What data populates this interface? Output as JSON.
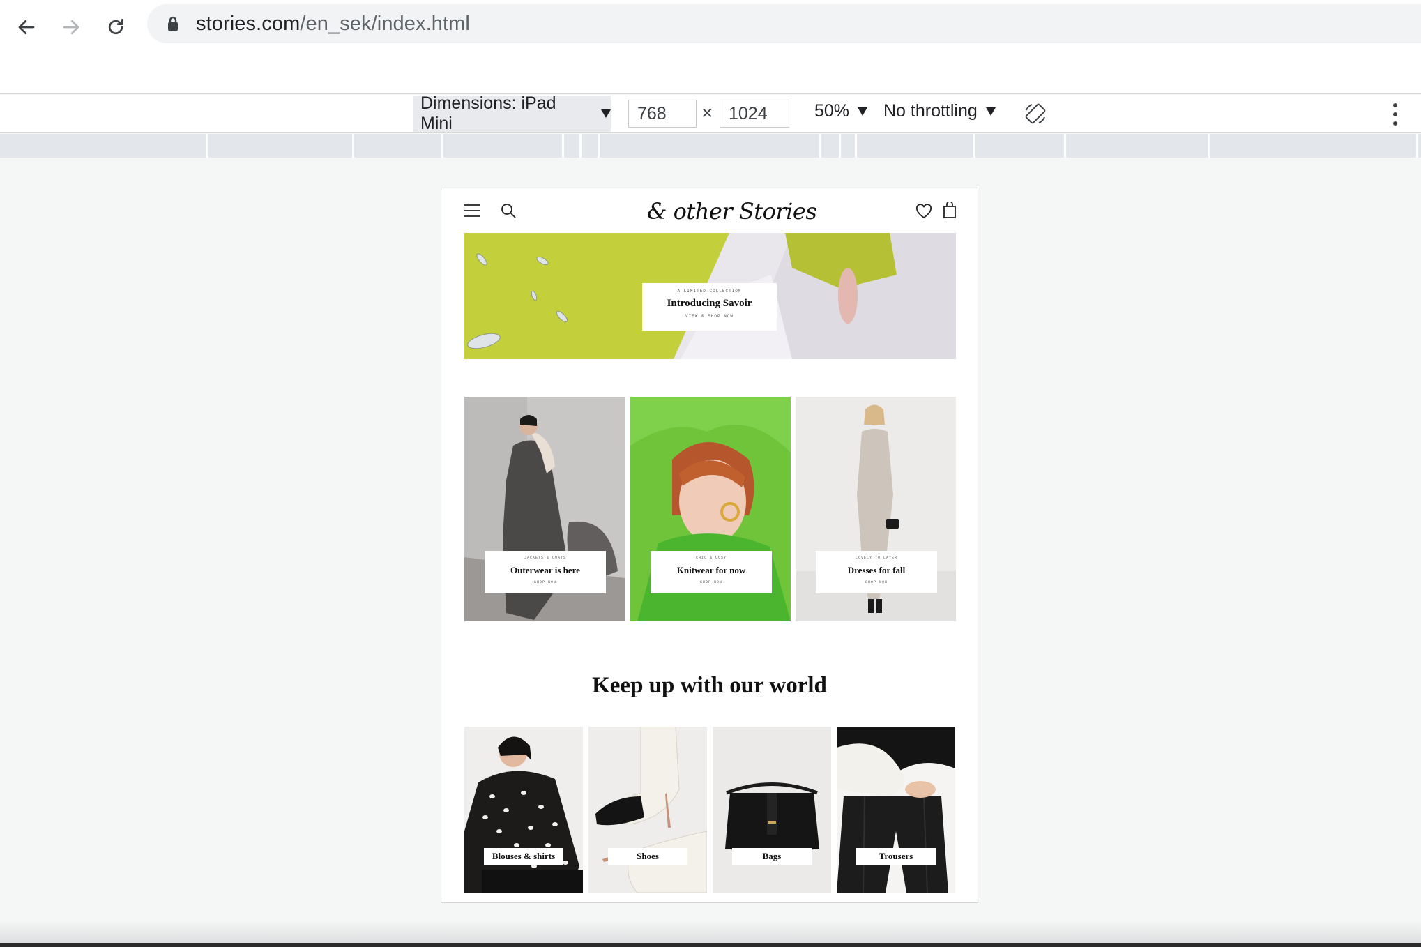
{
  "browser": {
    "url_host": "stories.com",
    "url_path": "/en_sek/index.html"
  },
  "devtools": {
    "dimensions_label": "Dimensions: iPad Mini",
    "width": "768",
    "times": "×",
    "height": "1024",
    "zoom": "50%",
    "throttling": "No throttling"
  },
  "site": {
    "logo": "& other Stories",
    "hero": {
      "kicker": "A LIMITED COLLECTION",
      "title": "Introducing Savoir",
      "cta": "VIEW & SHOP NOW"
    },
    "tiles": [
      {
        "kicker": "JACKETS & COATS",
        "title": "Outerwear is here",
        "cta": "SHOP NOW"
      },
      {
        "kicker": "CHIC & COSY",
        "title": "Knitwear for now",
        "cta": "SHOP NOW"
      },
      {
        "kicker": "LOVELY TO LAYER",
        "title": "Dresses for fall",
        "cta": "SHOP NOW"
      }
    ],
    "section_title": "Keep up with our world",
    "categories": [
      {
        "label": "Blouses & shirts"
      },
      {
        "label": "Shoes"
      },
      {
        "label": "Bags"
      },
      {
        "label": "Trousers"
      }
    ]
  },
  "colors": {
    "hero_lime": "#c3d03c",
    "knit_green": "#6fc43a"
  }
}
